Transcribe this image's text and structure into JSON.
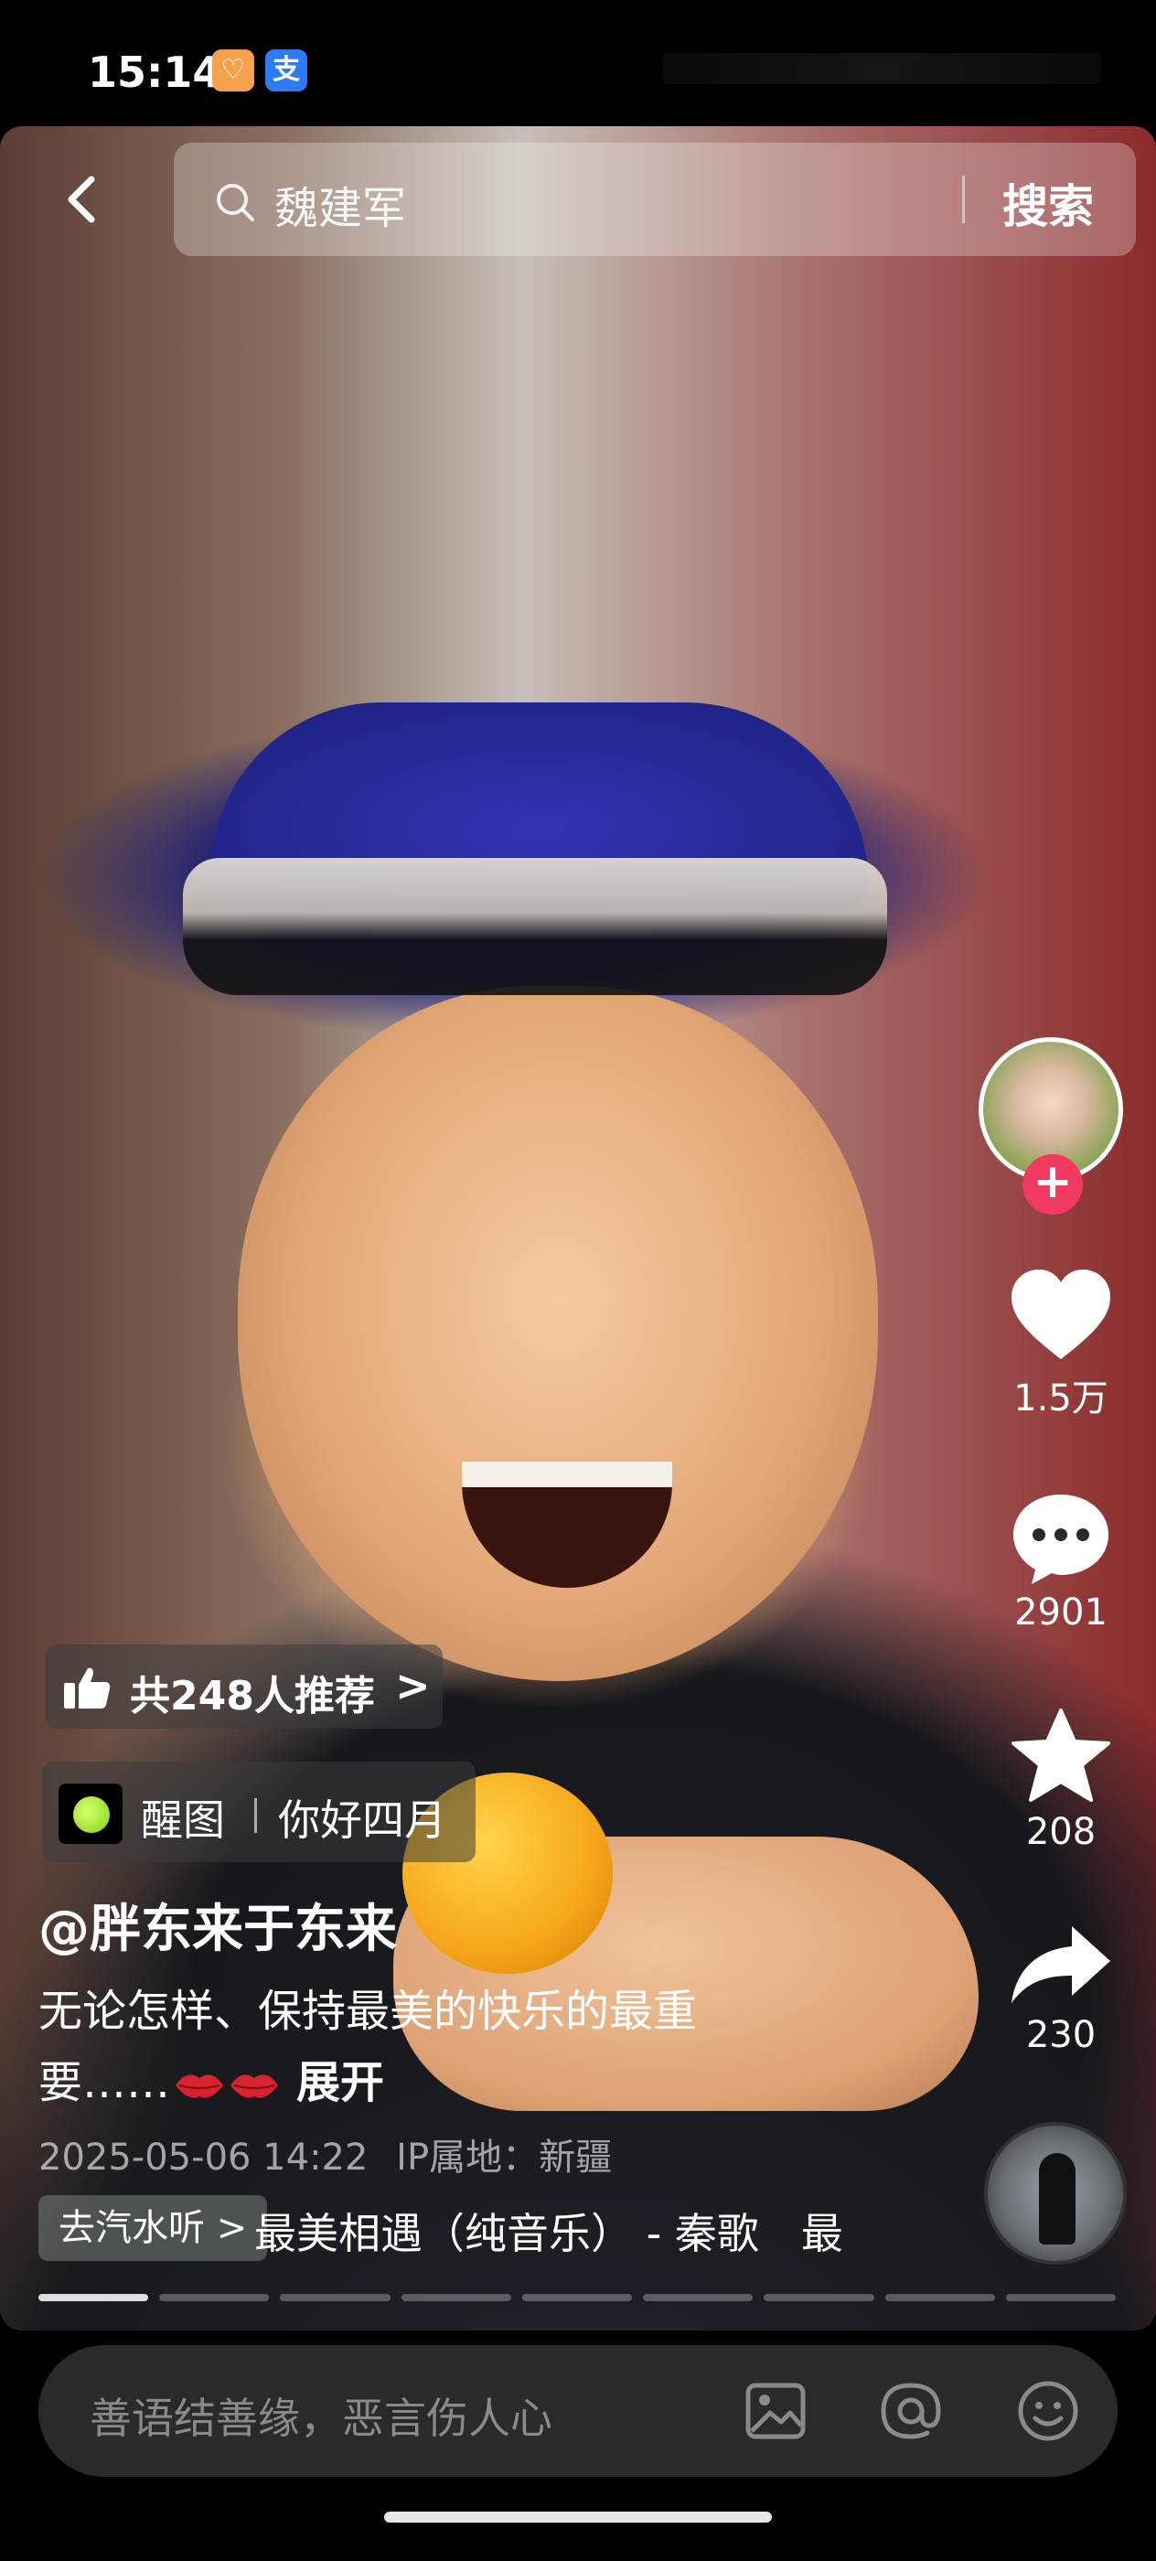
{
  "status_bar": {
    "time": "15:14",
    "badge1": "♡",
    "badge2": "支"
  },
  "search": {
    "query": "魏建军",
    "button_label": "搜索"
  },
  "recommend": {
    "label": "共248人推荐",
    "chevron": ">"
  },
  "app_chip": {
    "app_name": "醒图",
    "subtitle": "你好四月"
  },
  "post": {
    "author": "@胖东来于东来",
    "description": "无论怎样、保持最美的快乐的最重要……",
    "expand_label": "展开",
    "date": "2025-05-06 14:22",
    "location": "IP属地：新疆"
  },
  "music": {
    "button_label": "去汽水听 >",
    "title": "最美相遇（纯音乐） - 秦歌　最"
  },
  "actions": {
    "likes": "1.5万",
    "comments": "2901",
    "favorites": "208",
    "shares": "230"
  },
  "progress": {
    "segments": 9,
    "active_index": 0
  },
  "comment_bar": {
    "placeholder": "善语结善缘，恶言伤人心"
  },
  "colors": {
    "follow_plus": "#f03a5f",
    "background": "#000000"
  }
}
